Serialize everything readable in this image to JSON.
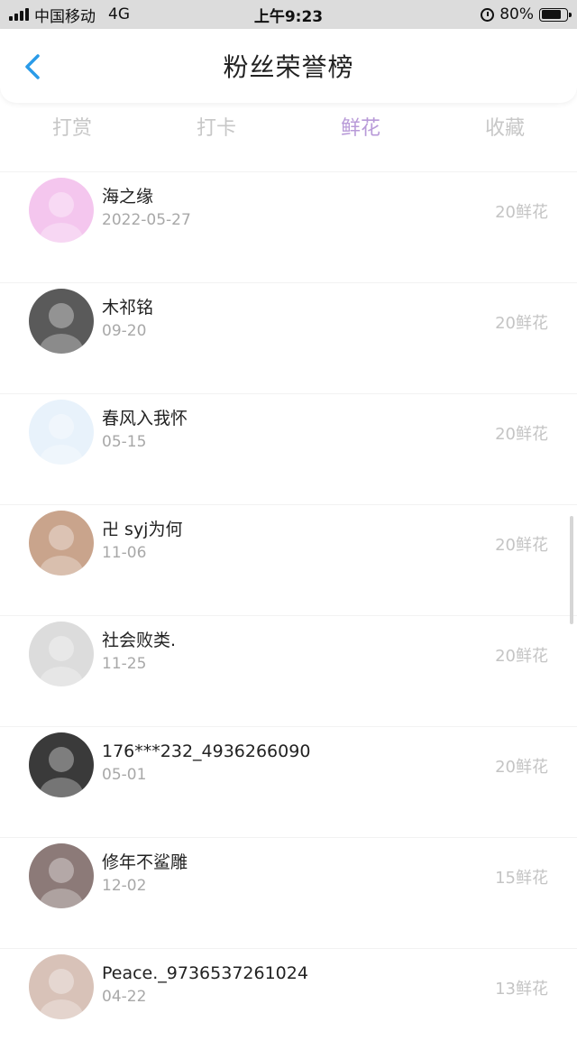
{
  "status_bar": {
    "carrier": "中国移动",
    "network": "4G",
    "time": "上午9:23",
    "battery_text": "80%",
    "battery_level": 0.8
  },
  "nav": {
    "title": "粉丝荣誉榜",
    "back_icon": "chevron-left-icon",
    "accent_color": "#2a9be8"
  },
  "tabs": [
    {
      "label": "打赏",
      "active": false
    },
    {
      "label": "打卡",
      "active": false
    },
    {
      "label": "鲜花",
      "active": true
    },
    {
      "label": "收藏",
      "active": false
    }
  ],
  "active_tab_color": "#b89ad8",
  "fans": [
    {
      "name": "海之缘",
      "date": "2022-05-27",
      "count": "20鲜花",
      "avatar_bg": "#f4c6ee"
    },
    {
      "name": "木祁铭",
      "date": "09-20",
      "count": "20鲜花",
      "avatar_bg": "#5a5a5a"
    },
    {
      "name": "春风入我怀",
      "date": "05-15",
      "count": "20鲜花",
      "avatar_bg": "#e8f2fb"
    },
    {
      "name": "卍 syj为何",
      "date": "11-06",
      "count": "20鲜花",
      "avatar_bg": "#c9a48c"
    },
    {
      "name": "社会败类.",
      "date": "11-25",
      "count": "20鲜花",
      "avatar_bg": "#dcdcdc"
    },
    {
      "name": "176***232_4936266090",
      "date": "05-01",
      "count": "20鲜花",
      "avatar_bg": "#3a3a3a"
    },
    {
      "name": "修年不鲨雕",
      "date": "12-02",
      "count": "15鲜花",
      "avatar_bg": "#8c7a78"
    },
    {
      "name": "Peace._9736537261024",
      "date": "04-22",
      "count": "13鲜花",
      "avatar_bg": "#d8c2b8"
    }
  ]
}
